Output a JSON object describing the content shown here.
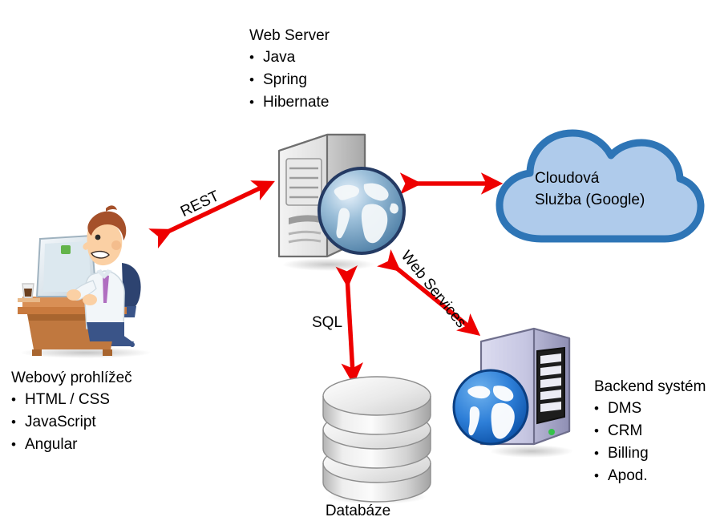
{
  "diagram": {
    "title": "Web application architecture diagram",
    "background_color": "#FFFFFF",
    "arrow_color": "#EE0000",
    "cloud_fill": "#AFCBEB",
    "cloud_stroke": "#2E75B6",
    "nodes": {
      "web_server": {
        "title": "Web Server",
        "bullets": [
          "Java",
          "Spring",
          "Hibernate"
        ],
        "icon": "server-tower-with-globe-icon"
      },
      "browser": {
        "title": "Webový prohlížeč",
        "bullets": [
          "HTML / CSS",
          "JavaScript",
          "Angular"
        ],
        "icon": "person-at-computer-icon"
      },
      "backend": {
        "title": "Backend systém",
        "bullets": [
          "DMS",
          "CRM",
          "Billing",
          "Apod."
        ],
        "icon": "server-rack-with-globe-icon"
      },
      "cloud": {
        "line1": "Cloudová",
        "line2": "Služba (Google)",
        "icon": "cloud-shape-icon"
      },
      "database": {
        "caption": "Databáze",
        "icon": "database-cylinder-icon"
      }
    },
    "connections": [
      {
        "label": "REST",
        "from": "browser",
        "to": "web_server",
        "style": "double-arrow"
      },
      {
        "label": "",
        "from": "web_server",
        "to": "cloud",
        "style": "double-arrow"
      },
      {
        "label": "SQL",
        "from": "web_server",
        "to": "database",
        "style": "double-arrow"
      },
      {
        "label": "Web Services",
        "from": "web_server",
        "to": "backend",
        "style": "double-arrow"
      }
    ]
  }
}
